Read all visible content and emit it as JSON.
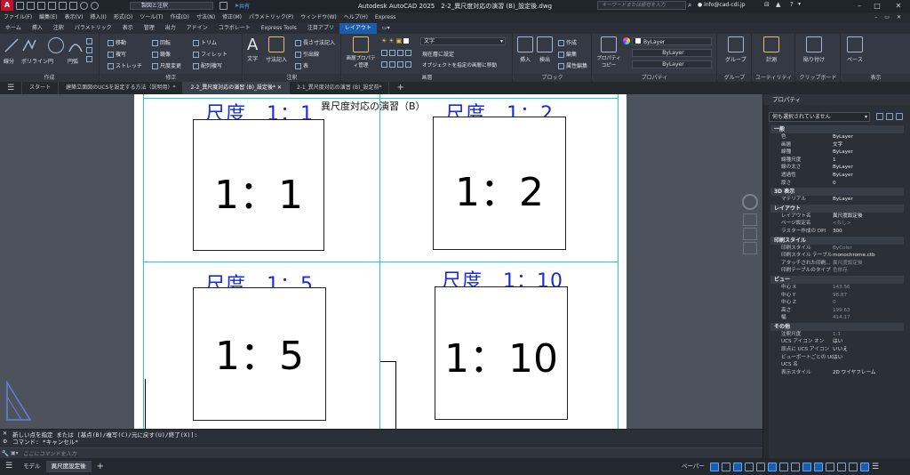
{
  "titlebar": {
    "app_letter": "A",
    "workspace": "製図と注釈",
    "share": "共有",
    "title": "Autodesk AutoCAD 2025　2-2_異尺度対応の演習 (B)_設定後.dwg",
    "search_placeholder": "キーワードまたは語句を入力",
    "user": "info@cad-cdi.jp"
  },
  "menu": [
    "ファイル(F)",
    "編集(E)",
    "表示(V)",
    "挿入(I)",
    "形式(O)",
    "ツール(T)",
    "作成(D)",
    "寸法(N)",
    "修正(M)",
    "パラメトリック(P)",
    "ウィンドウ(W)",
    "ヘルプ(H)",
    "Express"
  ],
  "ribbon_tabs": [
    "ホーム",
    "挿入",
    "注釈",
    "パラメトリック",
    "表示",
    "管理",
    "出力",
    "アドイン",
    "コラボレート",
    "Express Tools",
    "注目アプリ",
    "レイアウト"
  ],
  "ribbon_tab_active": "レイアウト",
  "ribbon": {
    "draw": {
      "label": "作成",
      "tools": [
        "線分",
        "ポリライン",
        "円",
        "円弧"
      ]
    },
    "modify": {
      "label": "修正",
      "tools": [
        "移動",
        "回転",
        "トリム",
        "複写",
        "鏡像",
        "フィレット",
        "ストレッチ",
        "尺度変更",
        "配列複写"
      ]
    },
    "annotation": {
      "label": "注釈",
      "tools": [
        "文字",
        "寸法記入",
        "長さ寸法記入",
        "引出線",
        "表"
      ]
    },
    "layers": {
      "label": "画層",
      "tools": [
        "画層プロパティ管理",
        "現在層に設定",
        "オブジェクトを指定の画層に移動"
      ],
      "layer_value": "文字"
    },
    "block": {
      "label": "ブロック",
      "tools": [
        "挿入",
        "検出",
        "作成",
        "編集",
        "属性編集"
      ]
    },
    "properties": {
      "label": "プロパティ",
      "tools": [
        "プロパティコピー"
      ],
      "color": "ByLayer",
      "linetype": "ByLayer",
      "lineweight": "ByLayer"
    },
    "groups": {
      "label": "グループ",
      "tools": [
        "グループ"
      ]
    },
    "utilities": {
      "label": "ユーティリティ",
      "tools": [
        "計測"
      ]
    },
    "clipboard": {
      "label": "クリップボード",
      "tools": [
        "貼り付け"
      ]
    },
    "view": {
      "label": "表示",
      "tools": [
        "ベース"
      ]
    }
  },
  "doc_tabs": [
    "スタート",
    "建築立面図のUCSを設定する方法（説明用）*",
    "2-2_異尺度対応の演習 (B)_設定後*",
    "2-1_異尺度対応の演習 (B)_設定前*"
  ],
  "doc_tab_active": 2,
  "drawing": {
    "main_title": "異尺度対応の演習（B）",
    "viewports": [
      {
        "label": "尺度　1：1",
        "frame_text": "1：1"
      },
      {
        "label": "尺度　1：2",
        "frame_text": "1：2"
      },
      {
        "label": "尺度　1：5",
        "frame_text": "1：5"
      },
      {
        "label": "尺度　1：10",
        "frame_text": "1：10"
      }
    ]
  },
  "command": {
    "history": [
      "新しい点を指定 または [基点(B)/複写(C)/元に戻す(U)/終了(X)]:",
      "コマンド: *キャンセル*"
    ],
    "placeholder": "ここにコマンドを入力"
  },
  "status": {
    "layout_tabs": [
      "モデル",
      "異尺度設定後"
    ],
    "active_tab": "異尺度設定後",
    "paper_label": "ペーパー"
  },
  "properties": {
    "title": "プロパティ",
    "selection": "何も選択されていません",
    "sections": [
      {
        "name": "一般",
        "rows": [
          {
            "k": "色",
            "v": "ByLayer"
          },
          {
            "k": "画層",
            "v": "文字"
          },
          {
            "k": "線種",
            "v": "ByLayer"
          },
          {
            "k": "線種尺度",
            "v": "1"
          },
          {
            "k": "線の太さ",
            "v": "ByLayer"
          },
          {
            "k": "透過性",
            "v": "ByLayer"
          },
          {
            "k": "厚さ",
            "v": "0"
          }
        ]
      },
      {
        "name": "3D 表示",
        "rows": [
          {
            "k": "マテリアル",
            "v": "ByLayer"
          }
        ]
      },
      {
        "name": "レイアウト",
        "rows": [
          {
            "k": "レイアウト名",
            "v": "異尺度設定後"
          },
          {
            "k": "ページ設定名",
            "v": "<なし>",
            "dim": true
          },
          {
            "k": "ラスター作成の DPI",
            "v": "300"
          }
        ]
      },
      {
        "name": "印刷スタイル",
        "rows": [
          {
            "k": "印刷スタイル",
            "v": "ByColor",
            "dim": true
          },
          {
            "k": "印刷スタイル テーブル",
            "v": "monochrome.ctb"
          },
          {
            "k": "アタッチされた印刷...",
            "v": "異尺度設定後",
            "dim": true
          },
          {
            "k": "印刷テーブルのタイプ",
            "v": "色依存",
            "dim": true
          }
        ]
      },
      {
        "name": "ビュー",
        "rows": [
          {
            "k": "中心 X",
            "v": "143.56",
            "dim": true
          },
          {
            "k": "中心 Y",
            "v": "98.87",
            "dim": true
          },
          {
            "k": "中心 Z",
            "v": "0",
            "dim": true
          },
          {
            "k": "高さ",
            "v": "199.63",
            "dim": true
          },
          {
            "k": "幅",
            "v": "414.17",
            "dim": true
          }
        ]
      },
      {
        "name": "その他",
        "rows": [
          {
            "k": "注釈尺度",
            "v": "1:1",
            "dim": true
          },
          {
            "k": "UCS アイコン オン",
            "v": "はい"
          },
          {
            "k": "原点に UCS アイコン",
            "v": "いいえ"
          },
          {
            "k": "ビューポートごとの UCS",
            "v": "はい"
          },
          {
            "k": "UCS 名",
            "v": ""
          },
          {
            "k": "表示スタイル",
            "v": "2D ワイヤフレーム"
          }
        ]
      }
    ]
  }
}
